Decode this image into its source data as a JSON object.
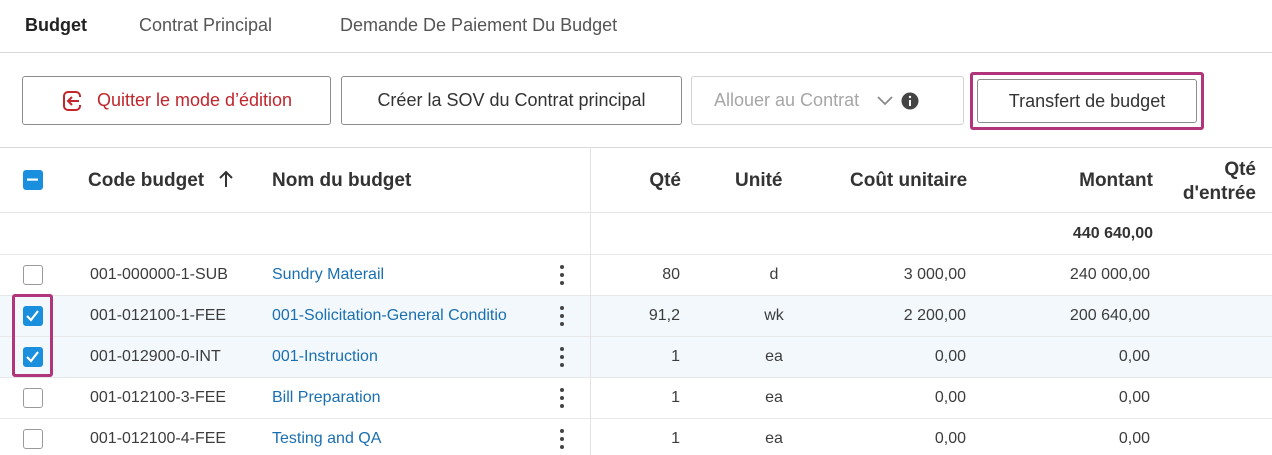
{
  "tabs": [
    {
      "label": "Budget",
      "active": true
    },
    {
      "label": "Contrat Principal",
      "active": false
    },
    {
      "label": "Demande De Paiement Du Budget",
      "active": false
    }
  ],
  "toolbar": {
    "quit_label": "Quitter le mode d’édition",
    "sov_label": "Créer la SOV du Contrat principal",
    "allocate_label": "Allouer au Contrat",
    "transfer_label": "Transfert de budget"
  },
  "table": {
    "headers": {
      "code": "Code budget",
      "name": "Nom du budget",
      "qty": "Qté",
      "unit": "Unité",
      "unit_cost": "Coût unitaire",
      "amount": "Montant",
      "input_qty_line1": "Qté",
      "input_qty_line2": "d'entrée"
    },
    "sort_icon": "arrow-up-icon",
    "total_amount": "440 640,00",
    "rows": [
      {
        "code": "001-000000-1-SUB",
        "name": "Sundry Materail",
        "qty": "80",
        "unit": "d",
        "unit_cost": "3 000,00",
        "amount": "240 000,00",
        "checked": false
      },
      {
        "code": "001-012100-1-FEE",
        "name": "001-Solicitation-General Conditio",
        "qty": "91,2",
        "unit": "wk",
        "unit_cost": "2 200,00",
        "amount": "200 640,00",
        "checked": true
      },
      {
        "code": "001-012900-0-INT",
        "name": "001-Instruction",
        "qty": "1",
        "unit": "ea",
        "unit_cost": "0,00",
        "amount": "0,00",
        "checked": true
      },
      {
        "code": "001-012100-3-FEE",
        "name": "Bill Preparation",
        "qty": "1",
        "unit": "ea",
        "unit_cost": "0,00",
        "amount": "0,00",
        "checked": false
      },
      {
        "code": "001-012100-4-FEE",
        "name": "Testing and QA",
        "qty": "1",
        "unit": "ea",
        "unit_cost": "0,00",
        "amount": "0,00",
        "checked": false
      }
    ]
  },
  "colors": {
    "accent": "#1a8fde",
    "link": "#1a6fb0",
    "danger": "#c0262d",
    "highlight": "#b0357a"
  }
}
